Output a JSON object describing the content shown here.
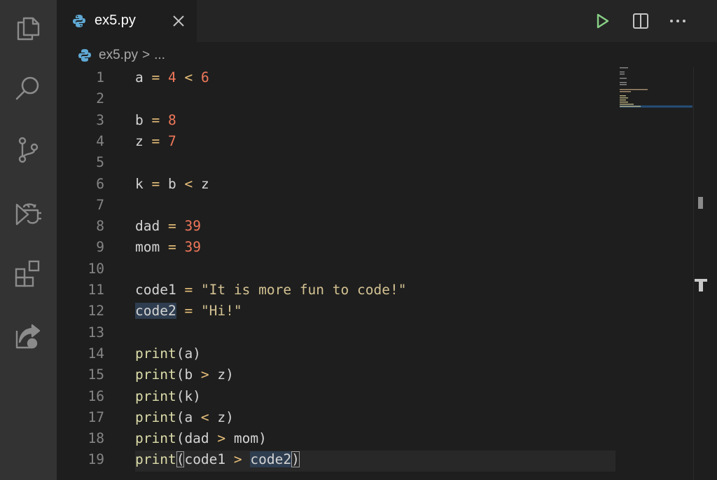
{
  "activity_bar": {
    "icons": [
      "explorer-icon",
      "search-icon",
      "source-control-icon",
      "run-debug-icon",
      "extensions-icon",
      "live-share-icon"
    ]
  },
  "tab": {
    "label": "ex5.py",
    "icon": "python-icon"
  },
  "breadcrumb": {
    "file": "ex5.py",
    "separator": ">",
    "more": "..."
  },
  "toolbar": {
    "icons": [
      "run-icon",
      "split-editor-icon",
      "more-actions-icon"
    ]
  },
  "colors": {
    "keyword": "#d4d4d4",
    "number": "#f0785a",
    "string": "#ce9178",
    "function": "#dcdcaa",
    "operator": "#d7ba7d",
    "run": "#89d185"
  },
  "editor": {
    "lines": [
      {
        "n": "1",
        "tokens": [
          {
            "t": "a",
            "c": "var"
          },
          {
            "t": " = ",
            "c": "op"
          },
          {
            "t": "4",
            "c": "num"
          },
          {
            "t": " < ",
            "c": "op"
          },
          {
            "t": "6",
            "c": "num"
          }
        ]
      },
      {
        "n": "2",
        "tokens": []
      },
      {
        "n": "3",
        "tokens": [
          {
            "t": "b",
            "c": "var"
          },
          {
            "t": " = ",
            "c": "op"
          },
          {
            "t": "8",
            "c": "num"
          }
        ]
      },
      {
        "n": "4",
        "tokens": [
          {
            "t": "z",
            "c": "var"
          },
          {
            "t": " = ",
            "c": "op"
          },
          {
            "t": "7",
            "c": "num"
          }
        ]
      },
      {
        "n": "5",
        "tokens": []
      },
      {
        "n": "6",
        "tokens": [
          {
            "t": "k",
            "c": "var"
          },
          {
            "t": " = ",
            "c": "op"
          },
          {
            "t": "b",
            "c": "var"
          },
          {
            "t": " < ",
            "c": "op"
          },
          {
            "t": "z",
            "c": "var"
          }
        ]
      },
      {
        "n": "7",
        "tokens": []
      },
      {
        "n": "8",
        "tokens": [
          {
            "t": "dad",
            "c": "var"
          },
          {
            "t": " = ",
            "c": "op"
          },
          {
            "t": "39",
            "c": "num"
          }
        ]
      },
      {
        "n": "9",
        "tokens": [
          {
            "t": "mom",
            "c": "var"
          },
          {
            "t": " = ",
            "c": "op"
          },
          {
            "t": "39",
            "c": "num"
          }
        ]
      },
      {
        "n": "10",
        "tokens": []
      },
      {
        "n": "11",
        "tokens": [
          {
            "t": "code1",
            "c": "var"
          },
          {
            "t": " = ",
            "c": "op"
          },
          {
            "t": "\"It is more fun to code!\"",
            "c": "str"
          }
        ]
      },
      {
        "n": "12",
        "tokens": [
          {
            "t": "code2",
            "c": "var hl"
          },
          {
            "t": " = ",
            "c": "op"
          },
          {
            "t": "\"Hi!\"",
            "c": "str"
          }
        ]
      },
      {
        "n": "13",
        "tokens": []
      },
      {
        "n": "14",
        "tokens": [
          {
            "t": "print",
            "c": "fn"
          },
          {
            "t": "(a)",
            "c": "var"
          }
        ]
      },
      {
        "n": "15",
        "tokens": [
          {
            "t": "print",
            "c": "fn"
          },
          {
            "t": "(b",
            "c": "var"
          },
          {
            "t": " > ",
            "c": "op"
          },
          {
            "t": "z)",
            "c": "var"
          }
        ]
      },
      {
        "n": "16",
        "tokens": [
          {
            "t": "print",
            "c": "fn"
          },
          {
            "t": "(k)",
            "c": "var"
          }
        ]
      },
      {
        "n": "17",
        "tokens": [
          {
            "t": "print",
            "c": "fn"
          },
          {
            "t": "(a",
            "c": "var"
          },
          {
            "t": " < ",
            "c": "op"
          },
          {
            "t": "z)",
            "c": "var"
          }
        ]
      },
      {
        "n": "18",
        "tokens": [
          {
            "t": "print",
            "c": "fn"
          },
          {
            "t": "(dad",
            "c": "var"
          },
          {
            "t": " > ",
            "c": "op"
          },
          {
            "t": "mom)",
            "c": "var"
          }
        ]
      },
      {
        "n": "19",
        "tokens": [
          {
            "t": "print",
            "c": "fn"
          },
          {
            "t": "(",
            "c": "var br"
          },
          {
            "t": "code1",
            "c": "var"
          },
          {
            "t": " > ",
            "c": "op"
          },
          {
            "t": "code2",
            "c": "var hl"
          },
          {
            "t": ")",
            "c": "var br"
          }
        ]
      }
    ]
  }
}
